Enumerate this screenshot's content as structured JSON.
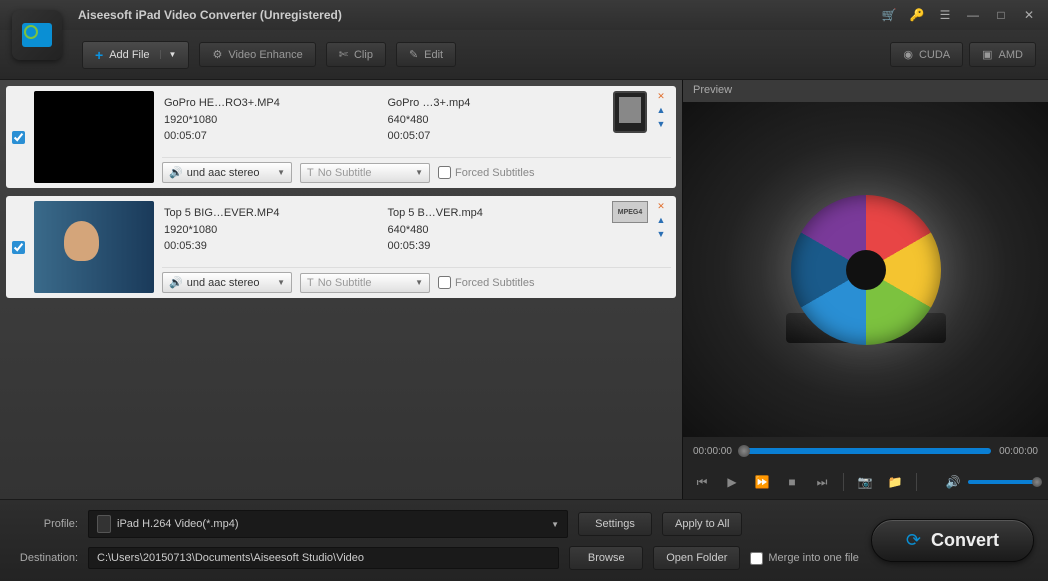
{
  "title": "Aiseesoft iPad Video Converter (Unregistered)",
  "toolbar": {
    "addfile": "Add File",
    "enhance": "Video Enhance",
    "clip": "Clip",
    "edit": "Edit",
    "cuda": "CUDA",
    "amd": "AMD"
  },
  "items": [
    {
      "src_name": "GoPro HE…RO3+.MP4",
      "src_res": "1920*1080",
      "src_dur": "00:05:07",
      "out_name": "GoPro …3+.mp4",
      "out_res": "640*480",
      "out_dur": "00:05:07",
      "audio": "und aac stereo",
      "subtitle": "No Subtitle",
      "forced": "Forced Subtitles"
    },
    {
      "src_name": "Top 5 BIG…EVER.MP4",
      "src_res": "1920*1080",
      "src_dur": "00:05:39",
      "out_name": "Top 5 B…VER.mp4",
      "out_res": "640*480",
      "out_dur": "00:05:39",
      "audio": "und aac stereo",
      "subtitle": "No Subtitle",
      "forced": "Forced Subtitles"
    }
  ],
  "preview": {
    "label": "Preview",
    "t1": "00:00:00",
    "t2": "00:00:00"
  },
  "bottom": {
    "profile_label": "Profile:",
    "profile_value": "iPad H.264 Video(*.mp4)",
    "dest_label": "Destination:",
    "dest_value": "C:\\Users\\20150713\\Documents\\Aiseesoft Studio\\Video",
    "settings": "Settings",
    "apply": "Apply to All",
    "browse": "Browse",
    "openfolder": "Open Folder",
    "merge": "Merge into one file",
    "convert": "Convert"
  }
}
